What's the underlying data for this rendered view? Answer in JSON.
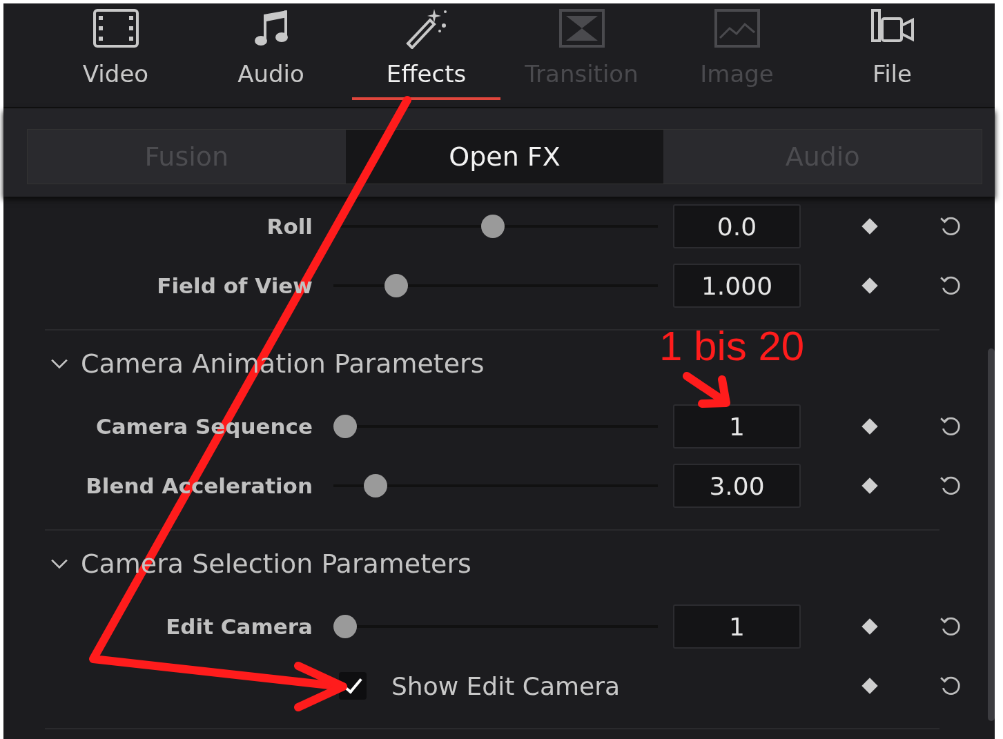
{
  "tabs": [
    {
      "label": "Video",
      "selected": false,
      "disabled": false
    },
    {
      "label": "Audio",
      "selected": false,
      "disabled": false
    },
    {
      "label": "Effects",
      "selected": true,
      "disabled": false
    },
    {
      "label": "Transition",
      "selected": false,
      "disabled": true
    },
    {
      "label": "Image",
      "selected": false,
      "disabled": true
    },
    {
      "label": "File",
      "selected": false,
      "disabled": false
    }
  ],
  "sub_tabs": [
    {
      "label": "Fusion",
      "selected": false,
      "disabled": true
    },
    {
      "label": "Open FX",
      "selected": true,
      "disabled": false
    },
    {
      "label": "Audio",
      "selected": false,
      "disabled": true
    }
  ],
  "parameters": [
    {
      "kind": "slider",
      "label": "Roll",
      "level": 0.49,
      "value": "0.0"
    },
    {
      "kind": "slider",
      "label": "Field of View",
      "level": 0.17,
      "value": "1.000"
    },
    {
      "kind": "section",
      "label": "Camera Animation Parameters",
      "expanded": true
    },
    {
      "kind": "slider",
      "label": "Camera Sequence",
      "level": 0.0,
      "value": "1"
    },
    {
      "kind": "slider",
      "label": "Blend Acceleration",
      "level": 0.1,
      "value": "3.00"
    },
    {
      "kind": "section",
      "label": "Camera Selection Parameters",
      "expanded": true
    },
    {
      "kind": "slider",
      "label": "Edit Camera",
      "level": 0.0,
      "value": "1"
    },
    {
      "kind": "checkbox",
      "label": "Show Edit Camera",
      "checked": true
    }
  ],
  "annotation": {
    "text": "1 bis 20"
  }
}
